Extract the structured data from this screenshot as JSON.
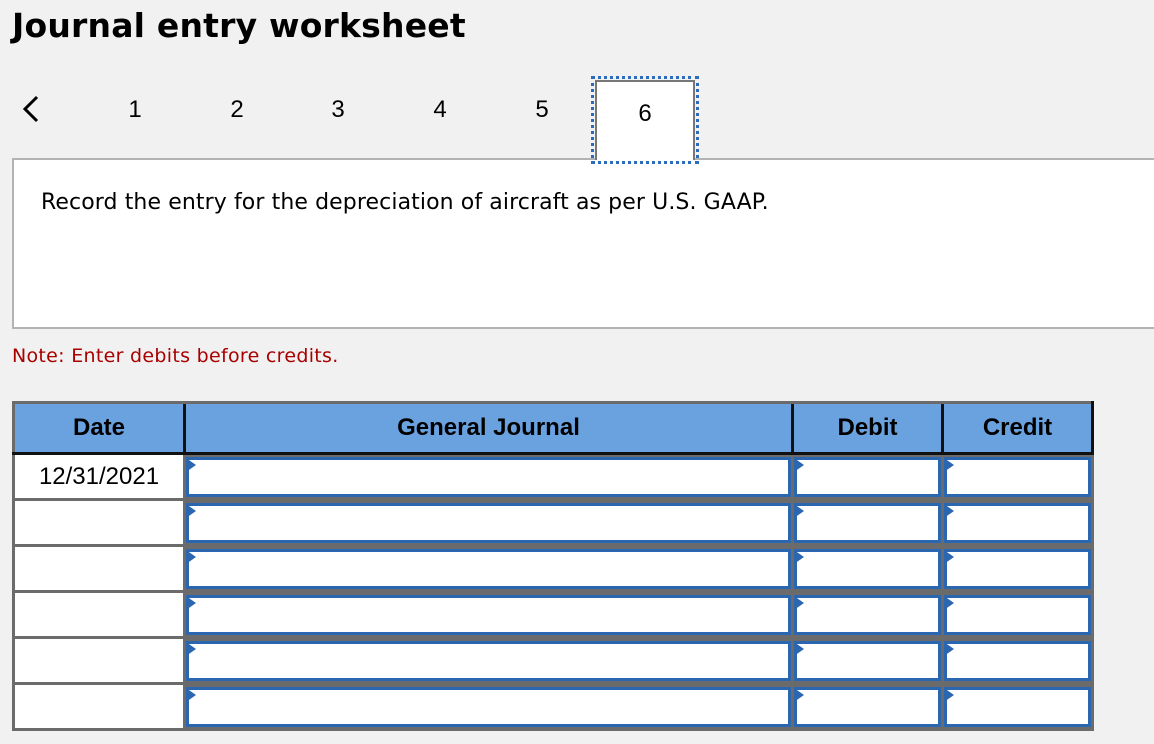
{
  "title": "Journal entry worksheet",
  "navigation": {
    "prev_icon": "chevron-left-icon",
    "steps": [
      {
        "label": "1",
        "active": false
      },
      {
        "label": "2",
        "active": false
      },
      {
        "label": "3",
        "active": false
      },
      {
        "label": "4",
        "active": false
      },
      {
        "label": "5",
        "active": false
      },
      {
        "label": "6",
        "active": true
      }
    ]
  },
  "question": {
    "text": "Record the entry for the depreciation of aircraft as per U.S. GAAP."
  },
  "note": "Note: Enter debits before credits.",
  "journal": {
    "columns": [
      "Date",
      "General Journal",
      "Debit",
      "Credit"
    ],
    "rows": [
      {
        "date": "12/31/2021",
        "account": "",
        "debit": "",
        "credit": ""
      },
      {
        "date": "",
        "account": "",
        "debit": "",
        "credit": ""
      },
      {
        "date": "",
        "account": "",
        "debit": "",
        "credit": ""
      },
      {
        "date": "",
        "account": "",
        "debit": "",
        "credit": ""
      },
      {
        "date": "",
        "account": "",
        "debit": "",
        "credit": ""
      },
      {
        "date": "",
        "account": "",
        "debit": "",
        "credit": ""
      }
    ]
  },
  "colors": {
    "header_blue": "#6aa2e0",
    "input_border_blue": "#2b66b0",
    "note_red": "#a80000",
    "active_tab_outline": "#2d6cbd"
  }
}
